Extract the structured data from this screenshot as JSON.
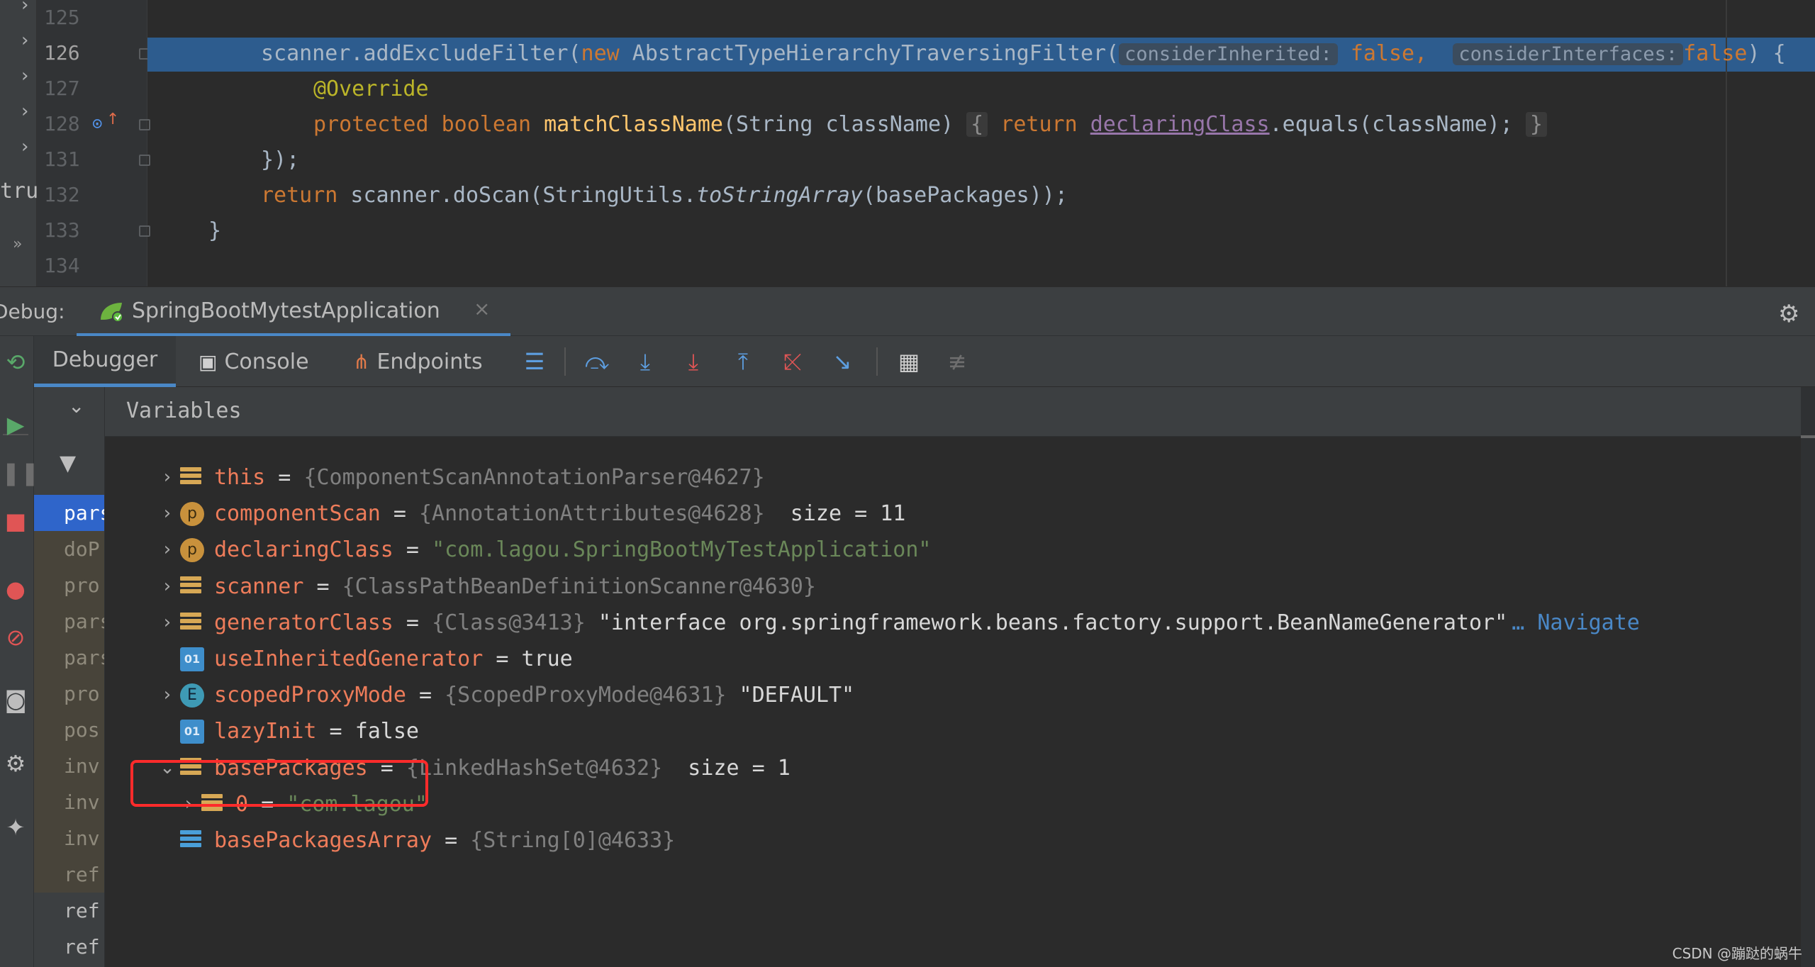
{
  "editor": {
    "line_numbers": [
      "125",
      "126",
      "127",
      "128",
      "131",
      "132",
      "133",
      "134"
    ],
    "project_fragment": "tru",
    "lines": {
      "l126": {
        "a": "scanner.addExcludeFilter(",
        "kw_new": "new",
        "b": " AbstractTypeHierarchyTraversingFilter(",
        "hint1": "considerInherited:",
        "hint1_val": "false,",
        "hint2": "considerInterfaces:",
        "hint2_val": "false",
        "c": ") {"
      },
      "l127": {
        "ann": "@Override"
      },
      "l128": {
        "kw1": "protected",
        "kw2": "boolean",
        "fn": "matchClassName",
        "params": "(String className)",
        "open": "{",
        "kw_return": "return",
        "field": "declaringClass",
        "rest": ".equals(className);",
        "close": "}"
      },
      "l131": {
        "text": "});"
      },
      "l132": {
        "kw_return": "return",
        "a": " scanner.doScan(StringUtils.",
        "ital": "toStringArray",
        "b": "(basePackages));"
      },
      "l133": {
        "text": "}"
      }
    }
  },
  "debug": {
    "label": "Debug:",
    "run_config": "SpringBootMytestApplication",
    "close_glyph": "×"
  },
  "toolbar": {
    "tabs": [
      {
        "label": "Debugger"
      },
      {
        "label": "Console"
      },
      {
        "label": "Endpoints"
      }
    ]
  },
  "frames": {
    "items": [
      {
        "label": "pars",
        "kind": "sel"
      },
      {
        "label": "doP",
        "kind": "lib"
      },
      {
        "label": "pro",
        "kind": "lib"
      },
      {
        "label": "pars",
        "kind": "lib"
      },
      {
        "label": "pars",
        "kind": "lib"
      },
      {
        "label": "pro",
        "kind": "lib"
      },
      {
        "label": "pos",
        "kind": "lib"
      },
      {
        "label": "inv",
        "kind": "lib"
      },
      {
        "label": "inv",
        "kind": "lib"
      },
      {
        "label": "inv",
        "kind": "lib"
      },
      {
        "label": "ref",
        "kind": "lib"
      },
      {
        "label": "ref",
        "kind": "user"
      },
      {
        "label": "ref",
        "kind": "user"
      }
    ]
  },
  "variables": {
    "title": "Variables",
    "rows": [
      {
        "name": "this",
        "eq": " = ",
        "gray": "{ComponentScanAnnotationParser@4627}",
        "extra": "",
        "str": "",
        "nav": "",
        "icon": "lines",
        "expand": "›",
        "indent": 0
      },
      {
        "name": "componentScan",
        "eq": " = ",
        "gray": "{AnnotationAttributes@4628}",
        "extra": "  size = 11",
        "str": "",
        "nav": "",
        "icon": "p",
        "expand": "›",
        "indent": 0
      },
      {
        "name": "declaringClass",
        "eq": " = ",
        "gray": "",
        "extra": "",
        "str": "\"com.lagou.SpringBootMyTestApplication\"",
        "nav": "",
        "icon": "p",
        "expand": "›",
        "indent": 0
      },
      {
        "name": "scanner",
        "eq": " = ",
        "gray": "{ClassPathBeanDefinitionScanner@4630}",
        "extra": "",
        "str": "",
        "nav": "",
        "icon": "lines",
        "expand": "›",
        "indent": 0
      },
      {
        "name": "generatorClass",
        "eq": " = ",
        "gray": "{Class@3413}",
        "extra": " \"interface org.springframework.beans.factory.support.BeanNameGenerator\"",
        "str": "",
        "nav": "… Navigate",
        "icon": "lines",
        "expand": "›",
        "indent": 0
      },
      {
        "name": "useInheritedGenerator",
        "eq": " = ",
        "gray": "",
        "extra": "true",
        "str": "",
        "nav": "",
        "icon": "01",
        "expand": "",
        "indent": 0
      },
      {
        "name": "scopedProxyMode",
        "eq": " = ",
        "gray": "{ScopedProxyMode@4631}",
        "extra": " \"DEFAULT\"",
        "str": "",
        "nav": "",
        "icon": "e",
        "expand": "›",
        "indent": 0
      },
      {
        "name": "lazyInit",
        "eq": " = ",
        "gray": "",
        "extra": "false",
        "str": "",
        "nav": "",
        "icon": "01",
        "expand": "",
        "indent": 0
      },
      {
        "name": "basePackages",
        "eq": " = ",
        "gray": "{LinkedHashSet@4632}",
        "extra": "  size = 1",
        "str": "",
        "nav": "",
        "icon": "lines",
        "expand": "⌄",
        "indent": 0
      },
      {
        "name": "0",
        "eq": " = ",
        "gray": "",
        "extra": "",
        "str": "\"com.lagou\"",
        "nav": "",
        "icon": "lines",
        "expand": "›",
        "indent": 1
      },
      {
        "name": "basePackagesArray",
        "eq": " = ",
        "gray": "{String[0]@4633}",
        "extra": "",
        "str": "",
        "nav": "",
        "icon": "array",
        "expand": "",
        "indent": 0
      }
    ]
  },
  "watermark": "CSDN @蹦跶的蜗牛",
  "icons": {
    "gear": "gear-icon",
    "filter": "filter-icon",
    "run_config": "spring-boot-icon"
  },
  "colors": {
    "selection": "#2d5c8e",
    "keyword": "#cc7832",
    "string": "#6a8759",
    "var_name": "#ee7c5a",
    "highlight_box": "#ff2b2b",
    "tab_accent": "#4a88c7"
  }
}
